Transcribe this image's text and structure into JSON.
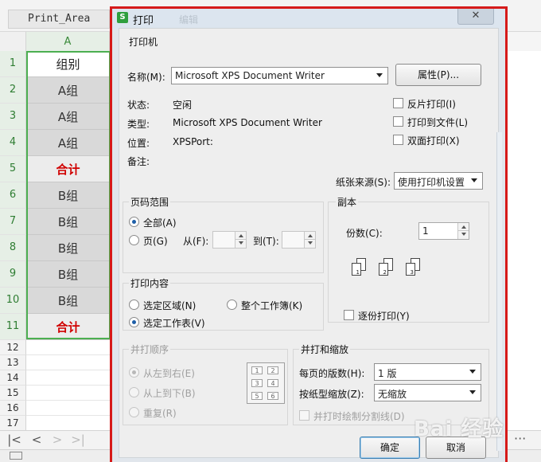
{
  "spreadsheet": {
    "name_box": "Print_Area",
    "column_a": "A",
    "rows": [
      {
        "num": "1",
        "text": "组别",
        "style": "white"
      },
      {
        "num": "2",
        "text": "A组",
        "style": "gray"
      },
      {
        "num": "3",
        "text": "A组",
        "style": "gray"
      },
      {
        "num": "4",
        "text": "A组",
        "style": "gray"
      },
      {
        "num": "5",
        "text": "合计",
        "style": "red"
      },
      {
        "num": "6",
        "text": "B组",
        "style": "gray"
      },
      {
        "num": "7",
        "text": "B组",
        "style": "gray"
      },
      {
        "num": "8",
        "text": "B组",
        "style": "gray"
      },
      {
        "num": "9",
        "text": "B组",
        "style": "gray"
      },
      {
        "num": "10",
        "text": "B组",
        "style": "gray"
      },
      {
        "num": "11",
        "text": "合计",
        "style": "red"
      }
    ],
    "empty_rows": [
      "12",
      "13",
      "14",
      "15",
      "16",
      "17"
    ],
    "more": "···"
  },
  "dialog": {
    "app_icon": "S",
    "title": "打印",
    "ghost_title": "编辑",
    "close": "✕",
    "printer": {
      "group_label": "打印机",
      "name_label": "名称(M):",
      "name_value": "Microsoft XPS Document Writer",
      "properties_button": "属性(P)...",
      "status_label": "状态:",
      "status_value": "空闲",
      "type_label": "类型:",
      "type_value": "Microsoft XPS Document Writer",
      "location_label": "位置:",
      "location_value": "XPSPort:",
      "comment_label": "备注:",
      "reverse_print": "反片打印(I)",
      "print_to_file": "打印到文件(L)",
      "duplex": "双面打印(X)",
      "paper_source_label": "纸张来源(S):",
      "paper_source_value": "使用打印机设置"
    },
    "page_range": {
      "group_label": "页码范围",
      "all": "全部(A)",
      "pages": "页(G)",
      "from_label": "从(F):",
      "to_label": "到(T):"
    },
    "copies": {
      "group_label": "副本",
      "count_label": "份数(C):",
      "count_value": "1",
      "collate": "逐份打印(Y)",
      "collate_pages": [
        "1",
        "2",
        "3"
      ]
    },
    "print_content": {
      "group_label": "打印内容",
      "selection": "选定区域(N)",
      "whole_workbook": "整个工作簿(K)",
      "active_sheet": "选定工作表(V)"
    },
    "print_order": {
      "group_label": "并打顺序",
      "left_to_right": "从左到右(E)",
      "top_to_bottom": "从上到下(B)",
      "repeat": "重复(R)",
      "order_numbers": [
        "1",
        "2",
        "3",
        "4",
        "5",
        "6"
      ]
    },
    "zoom": {
      "group_label": "并打和缩放",
      "pages_per_sheet_label": "每页的版数(H):",
      "pages_per_sheet_value": "1 版",
      "scale_label": "按纸型缩放(Z):",
      "scale_value": "无缩放",
      "draw_dividers": "并打时绘制分割线(D)"
    },
    "ok_button": "确定",
    "cancel_button": "取消"
  },
  "watermark": "Bai 经验"
}
